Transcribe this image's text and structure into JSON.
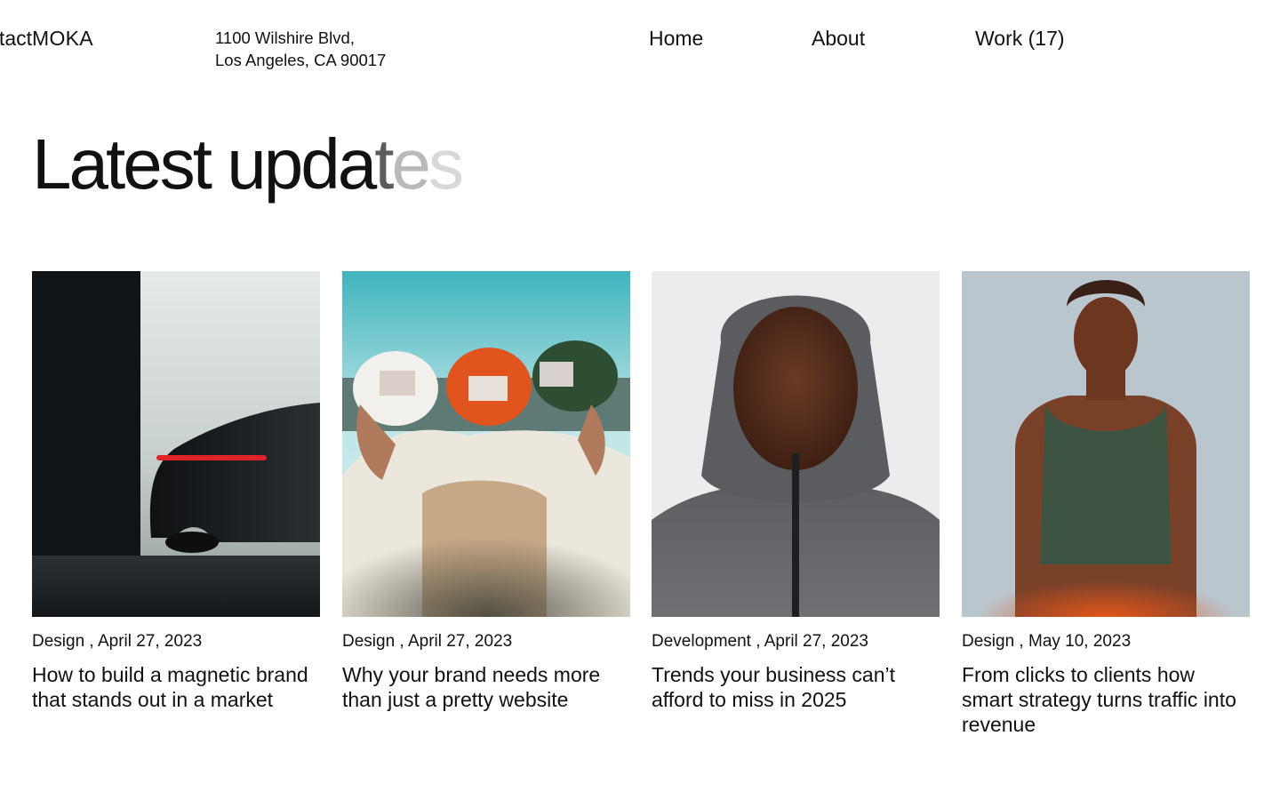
{
  "brand": {
    "name": "MOKA"
  },
  "address": {
    "line1": "1100 Wilshire Blvd,",
    "line2": "Los Angeles, CA 90017"
  },
  "nav": {
    "home": "Home",
    "about": "About",
    "work": "Work (17)",
    "contact": "Contact"
  },
  "section": {
    "headline": "Latest updates",
    "headline_fade_colors": [
      "#111111",
      "#111111",
      "#111111",
      "#111111",
      "#111111",
      "#111111",
      "#111111",
      "#111111",
      "#111111",
      "#111111",
      "#111111",
      "#5c5c5c",
      "#b9b9b9",
      "#d8d8d8"
    ]
  },
  "posts": [
    {
      "category": "Design",
      "date": "April 27, 2023",
      "title": "How to build a magnetic brand that stands out in a market",
      "image": "dark sports car tail light"
    },
    {
      "category": "Design",
      "date": "April 27, 2023",
      "title": "Why your brand needs more than just a pretty website",
      "image": "three people wearing caps"
    },
    {
      "category": "Development",
      "date": "April 27, 2023",
      "title": "Trends your business can’t afford to miss in 2025",
      "image": "man in grey hooded puffer jacket"
    },
    {
      "category": "Design",
      "date": "May 10, 2023",
      "title": "From clicks to clients how smart strategy turns traffic into revenue",
      "image": "man in green tank top"
    }
  ]
}
